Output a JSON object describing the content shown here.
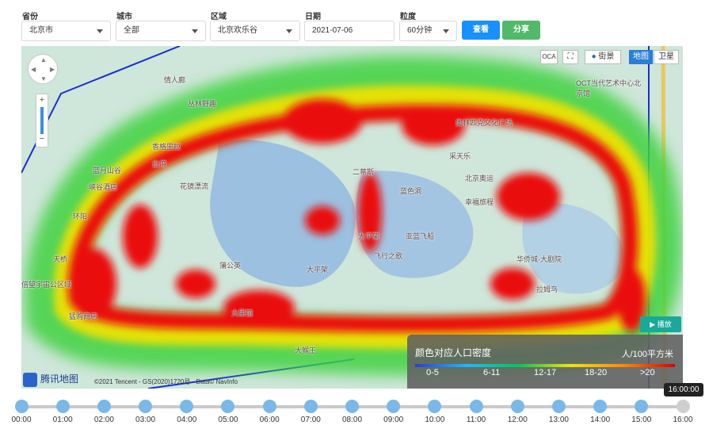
{
  "filters": {
    "province": {
      "label": "省份",
      "value": "北京市"
    },
    "city": {
      "label": "城市",
      "value": "全部"
    },
    "district": {
      "label": "区域",
      "value": "北京欢乐谷"
    },
    "date": {
      "label": "日期",
      "value": "2021-07-06"
    },
    "granularity": {
      "label": "粒度",
      "value": "60分钟"
    },
    "query_label": "查看",
    "share_label": "分享",
    "query_color": "#1890ff",
    "share_color": "#52b96a"
  },
  "map": {
    "buttons": {
      "street": "街景",
      "map": "地图",
      "satellite": "卫星",
      "ocr": "OCA"
    },
    "labels": [
      "情人廊",
      "丛林野趣",
      "香格里拉",
      "白湾",
      "蓝月山谷",
      "峡谷酒店",
      "花镜漂流",
      "环阳",
      "天桥",
      "倍望宇宙公区域",
      "猛购商店",
      "蒲公英",
      "大果馆",
      "大平架",
      "飞行之歌",
      "亚蓝飞船",
      "二蒂斯",
      "蓝色洞",
      "采天乐",
      "华侨城·大剧院",
      "奥林匹克文化广场",
      "OCT当代艺术中心北京馆",
      "北京奥运",
      "拉姆鸟",
      "幸福旅程",
      "大平架",
      "大猴王"
    ],
    "play_label": "▶ 播放",
    "logo_text": "腾讯地图",
    "copyright": "©2021 Tencent - GS(2020)1720号 - Data© NavInfo"
  },
  "legend": {
    "title": "颜色对应人口密度",
    "unit": "人/100平方米",
    "ranges": [
      "0-5",
      "6-11",
      "12-17",
      "18-20",
      ">20"
    ]
  },
  "timeline": {
    "current": "16:00:00",
    "hours": [
      "00:00",
      "01:00",
      "02:00",
      "03:00",
      "04:00",
      "05:00",
      "06:00",
      "07:00",
      "08:00",
      "09:00",
      "10:00",
      "11:00",
      "12:00",
      "13:00",
      "14:00",
      "15:00",
      "16:00"
    ]
  }
}
